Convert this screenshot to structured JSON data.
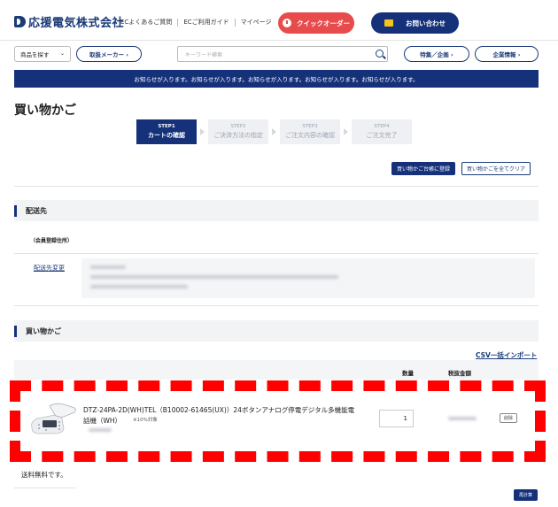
{
  "header": {
    "logo_text": "応援電気株式会社",
    "links": [
      "ECよくあるご質問",
      "ECご利用ガイド",
      "マイページ"
    ],
    "quick_order": "クイックオーダー",
    "contact": "お問い合わせ"
  },
  "subnav": {
    "product_search": "商品を探す",
    "manufacturer": "取扱メーカー ›",
    "search_placeholder": "キーワード検索",
    "feature": "特集／企画 ›",
    "company": "企業情報 ›"
  },
  "notice": "お知らせが入ります。お知らせが入ります。お知らせが入ります。お知らせが入ります。お知らせが入ります。",
  "page_title": "買い物かご",
  "steps": [
    {
      "num": "STEP1",
      "label": "カートの確認",
      "active": true
    },
    {
      "num": "STEP2",
      "label": "ご決済方法の指定",
      "active": false
    },
    {
      "num": "STEP3",
      "label": "ご注文内容の確認",
      "active": false
    },
    {
      "num": "STEP4",
      "label": "ご注文完了",
      "active": false
    }
  ],
  "actions": {
    "register": "買い物かご台帳に登録",
    "clear": "買い物かごを全てクリア"
  },
  "delivery": {
    "heading": "配送先",
    "member_label": "（会員登録住所）",
    "change_link": "配送先変更"
  },
  "cart": {
    "heading": "買い物かご",
    "csv_import": "CSV一括インポート",
    "col_qty": "数量",
    "col_price": "税抜金額",
    "item": {
      "name": "DTZ-24PA-2D(WH)TEL（B10002-61465(UX)）24ボタンアナログ停電デジタル多機能電話機（WH）",
      "tax_note": "※10%対象",
      "quantity": "1",
      "delete": "削除"
    },
    "shipping_note": "送料無料です。",
    "recalc": "再計算"
  },
  "colors": {
    "brand_navy": "#15317a",
    "quick_order_red": "#e84b4b",
    "highlight_dash": "#ff0000"
  }
}
